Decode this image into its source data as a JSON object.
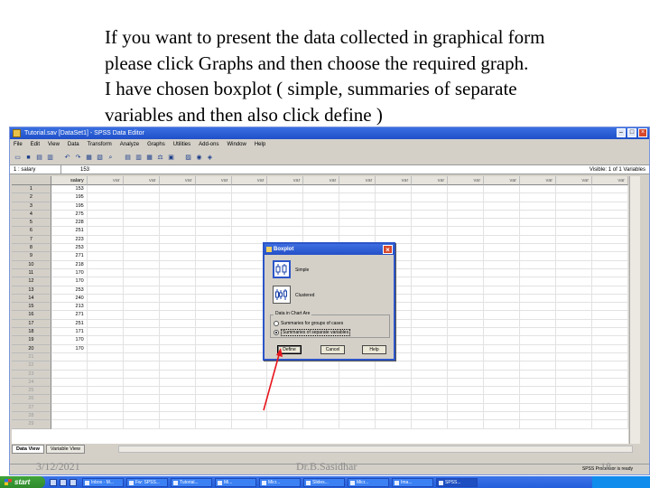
{
  "caption": {
    "lines": [
      "If you want to present the data collected in graphical form",
      "please click Graphs and then choose the required graph.",
      "I have chosen boxplot ( simple, summaries of separate",
      "variables and then also click define )"
    ]
  },
  "window": {
    "title": "Tutorial.sav [DataSet1] - SPSS Data Editor",
    "menu": [
      "File",
      "Edit",
      "View",
      "Data",
      "Transform",
      "Analyze",
      "Graphs",
      "Utilities",
      "Add-ons",
      "Window",
      "Help"
    ],
    "cell_ref": "1 : salary",
    "cell_value": "153",
    "visible_label": "Visible: 1 of 1 Variables",
    "status_text": "SPSS Processor is ready"
  },
  "grid": {
    "columns": [
      "salary",
      "var",
      "var",
      "var",
      "var",
      "var",
      "var",
      "var",
      "var",
      "var",
      "var",
      "var",
      "var",
      "var",
      "var",
      "var"
    ],
    "rows": [
      {
        "n": "1",
        "v": "153"
      },
      {
        "n": "2",
        "v": "195"
      },
      {
        "n": "3",
        "v": "195"
      },
      {
        "n": "4",
        "v": "275"
      },
      {
        "n": "5",
        "v": "228"
      },
      {
        "n": "6",
        "v": "251"
      },
      {
        "n": "7",
        "v": "223"
      },
      {
        "n": "8",
        "v": "253"
      },
      {
        "n": "9",
        "v": "271"
      },
      {
        "n": "10",
        "v": "218"
      },
      {
        "n": "11",
        "v": "170"
      },
      {
        "n": "12",
        "v": "170"
      },
      {
        "n": "13",
        "v": "253"
      },
      {
        "n": "14",
        "v": "240"
      },
      {
        "n": "15",
        "v": "213"
      },
      {
        "n": "16",
        "v": "271"
      },
      {
        "n": "17",
        "v": "251"
      },
      {
        "n": "18",
        "v": "171"
      },
      {
        "n": "19",
        "v": "170"
      },
      {
        "n": "20",
        "v": "170"
      },
      {
        "n": "21",
        "v": ""
      },
      {
        "n": "22",
        "v": ""
      },
      {
        "n": "23",
        "v": ""
      },
      {
        "n": "24",
        "v": ""
      },
      {
        "n": "25",
        "v": ""
      },
      {
        "n": "26",
        "v": ""
      },
      {
        "n": "27",
        "v": ""
      },
      {
        "n": "28",
        "v": ""
      },
      {
        "n": "29",
        "v": ""
      }
    ],
    "tabs": [
      "Data View",
      "Variable View"
    ]
  },
  "dialog": {
    "title": "Boxplot",
    "options": [
      {
        "label": "Simple",
        "icon": "simple-boxplot-icon"
      },
      {
        "label": "Clustered",
        "icon": "clustered-boxplot-icon"
      }
    ],
    "group_title": "Data in Chart Are",
    "radio_1": "Summaries for groups of cases",
    "radio_2": "Summaries of separate variables",
    "buttons": {
      "define": "Define",
      "cancel": "Cancel",
      "help": "Help"
    }
  },
  "taskbar": {
    "start": "start",
    "buttons": [
      "Inbox - M...",
      "Fw: SPSS...",
      "Tutorial...",
      "Mi...",
      "Micr...",
      "Slides...",
      "Micr...",
      "Ima...",
      "SPSS..."
    ]
  },
  "footer": {
    "date": "3/12/2021",
    "author": "Dr.B.Sasidhar",
    "page": "18"
  },
  "colors": {
    "title_bar": "#245edb",
    "arrow": "#e8141c",
    "start_button": "#2f8a2c"
  }
}
